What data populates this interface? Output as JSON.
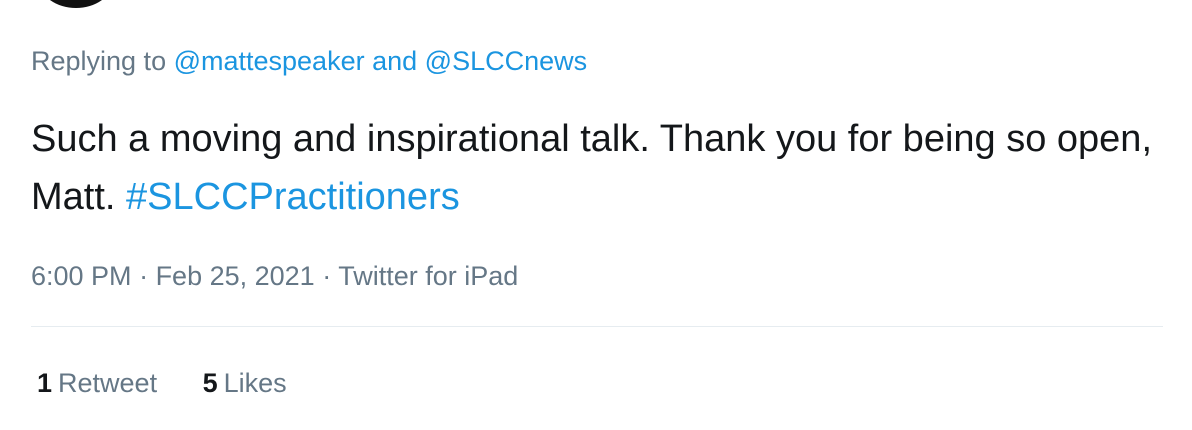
{
  "reply": {
    "prefix": "Replying to ",
    "mention1": "@mattespeaker",
    "joiner": " and ",
    "mention2": "@SLCCnews"
  },
  "tweet": {
    "text": "Such a moving and inspirational talk. Thank you for being so open, Matt. ",
    "hashtag": "#SLCCPractitioners"
  },
  "meta": {
    "time": "6:00 PM",
    "sep1": " · ",
    "date": "Feb 25, 2021",
    "sep2": " · ",
    "source": "Twitter for iPad"
  },
  "stats": {
    "retweets_count": "1",
    "retweets_label": "Retweet",
    "likes_count": "5",
    "likes_label": "Likes"
  },
  "colors": {
    "link": "#1b95e0",
    "secondary": "#657786",
    "text": "#14171a"
  }
}
